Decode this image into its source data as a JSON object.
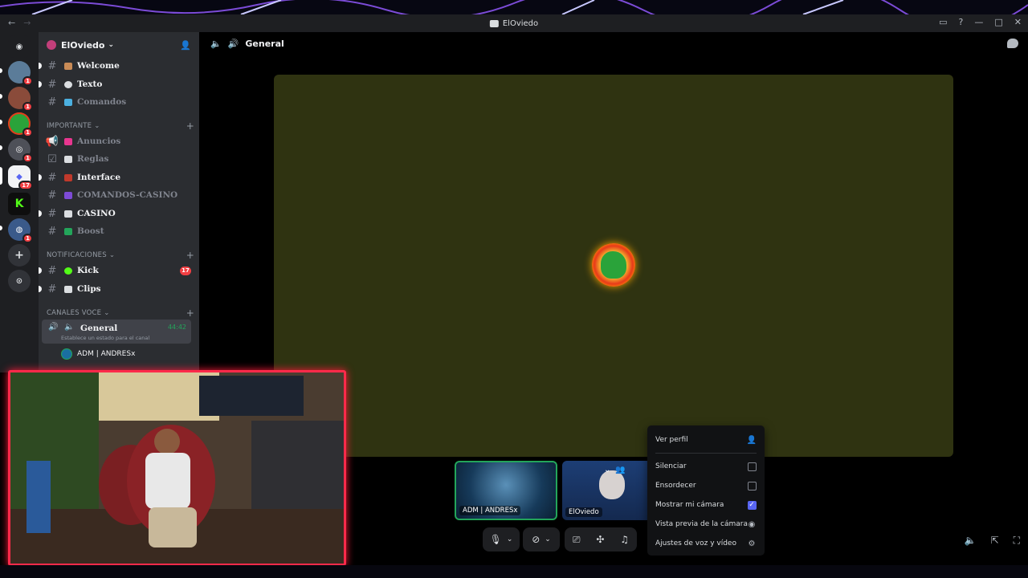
{
  "window": {
    "title": "ElOviedo"
  },
  "server": {
    "name": "ElOviedo"
  },
  "guild_badges": [
    "1",
    "1",
    "1",
    "1",
    "17",
    "",
    "1"
  ],
  "channels": [
    {
      "name": "Welcome",
      "unread": true,
      "emoji_color": "#c98b56"
    },
    {
      "name": "Texto",
      "unread": true,
      "emoji_color": "#dbdee1"
    },
    {
      "name": "Comandos",
      "unread": false,
      "emoji_color": "#4bb0e0"
    }
  ],
  "categories": {
    "importante": "IMPORTANTE",
    "notificaciones": "NOTIFICACIONES",
    "canales_voce": "CANALES VOCE"
  },
  "important_channels": [
    {
      "name": "Anuncios",
      "unread": false,
      "emoji_color": "#e8368f"
    },
    {
      "name": "Reglas",
      "unread": false,
      "emoji_color": "#dbdee1"
    },
    {
      "name": "Interface",
      "unread": true,
      "emoji_color": "#c0392b"
    },
    {
      "name": "COMANDOS-CASINO",
      "unread": false,
      "emoji_color": "#7d4bd6"
    },
    {
      "name": "CASINO",
      "unread": true,
      "emoji_color": "#dbdee1"
    },
    {
      "name": "Boost",
      "unread": false,
      "emoji_color": "#23a55a"
    }
  ],
  "notif_channels": [
    {
      "name": "Kick",
      "unread": true,
      "badge": "17",
      "emoji_color": "#53fc18"
    },
    {
      "name": "Clips",
      "unread": true,
      "emoji_color": "#dbdee1"
    }
  ],
  "voice_channel": {
    "name": "General",
    "time": "44:42",
    "status": "Establece un estado para el canal"
  },
  "voice_members": [
    {
      "name": "ADM | ANDRESx"
    }
  ],
  "stage": {
    "channel": "General"
  },
  "participants": [
    {
      "name": "ADM | ANDRESx"
    },
    {
      "name": "ElOviedo"
    }
  ],
  "context_menu": {
    "ver_perfil": "Ver perfil",
    "silenciar": "Silenciar",
    "ensordecer": "Ensordecer",
    "mostrar_camara": "Mostrar mi cámara",
    "vista_previa": "Vista previa de la cámara",
    "ajustes": "Ajustes de voz y vídeo",
    "mostrar_camara_checked": true
  },
  "colors": {
    "accent": "#5865f2",
    "live": "#23a55a",
    "badge": "#f23f43",
    "cam_border": "#ff2a4a"
  }
}
